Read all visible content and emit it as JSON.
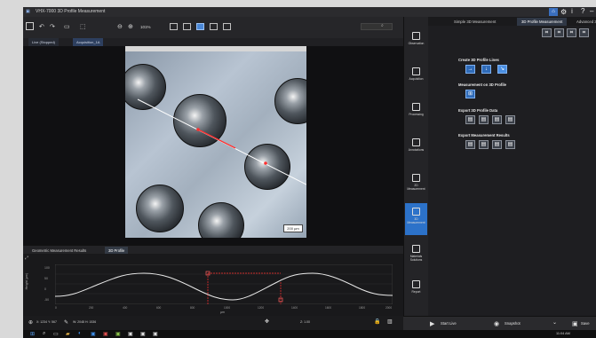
{
  "window": {
    "title": "VHX-7000 3D Profile Measurement"
  },
  "toolbar": {
    "items": [
      "↶",
      "↷",
      "▭",
      "⬚",
      "⊖",
      "⊕"
    ],
    "zoom": "101%"
  },
  "tabs": [
    "Live (Stopped)",
    "Acquisition_1A"
  ],
  "image": {
    "scale_label": "200 µm"
  },
  "bottom_tabs": [
    "Geometric Measurement Results",
    "3D Profile"
  ],
  "plot": {
    "y_label": "Height (µm)",
    "x_label": "µm",
    "y_ticks": [
      "100",
      "50",
      "0",
      "-50"
    ],
    "x_ticks": [
      "0",
      "200",
      "400",
      "600",
      "800",
      "1000",
      "1200",
      "1400",
      "1600",
      "1800",
      "2000"
    ]
  },
  "status": {
    "left": "X: 1234 Y: 567",
    "mid": "W: 2048 H: 1536",
    "right": "Z: 1.00"
  },
  "sidebar": {
    "items": [
      {
        "label": "Observation"
      },
      {
        "label": "Acquisition"
      },
      {
        "label": "Processing"
      },
      {
        "label": "Annotations"
      },
      {
        "label": "2D Measurement"
      },
      {
        "label": "3D Measurement"
      },
      {
        "label": "Materials Solutions"
      },
      {
        "label": "Report"
      }
    ]
  },
  "panel": {
    "tabs": [
      "Simple 3D Measurement",
      "3D Profile Measurement",
      "Advanced 3D Meas"
    ],
    "create_label": "Create 3D Profile Lines",
    "measurement_label": "Measurement on 3D Profile",
    "export_data_label": "Export 3D Profile Data",
    "export_results_label": "Export Measurement Results"
  },
  "bottom": {
    "start_live": "Start Live",
    "snapshot": "Snapshot",
    "save": "Save"
  },
  "taskbar": {
    "time": "11:04 AM"
  }
}
